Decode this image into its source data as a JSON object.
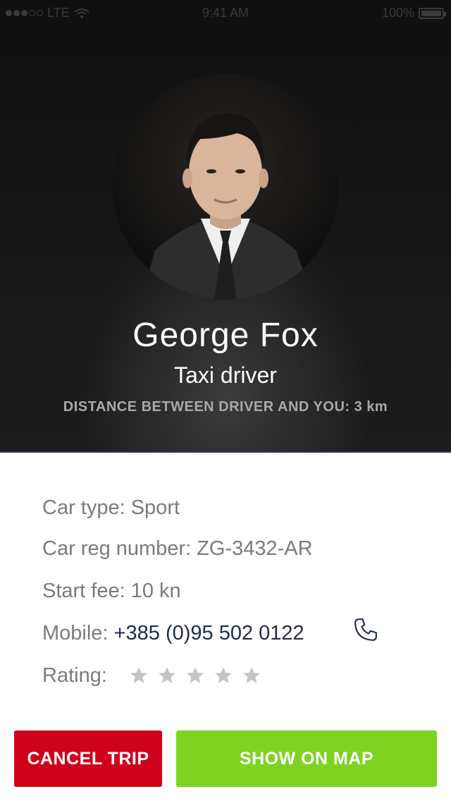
{
  "status_bar": {
    "carrier": "LTE",
    "time": "9:41 AM",
    "battery": "100%"
  },
  "driver": {
    "name": "George Fox",
    "role": "Taxi driver",
    "distance": "DISTANCE BETWEEN DRIVER AND YOU: 3 km"
  },
  "details": {
    "car_type": "Car type: Sport",
    "car_reg": "Car reg number: ZG-3432-AR",
    "start_fee": "Start fee: 10 kn",
    "mobile_label": "Mobile:",
    "mobile_value": "+385 (0)95 502 0122",
    "rating_label": "Rating:",
    "rating_stars": 5,
    "rating_filled": 0
  },
  "actions": {
    "cancel": "CANCEL TRIP",
    "map": "SHOW ON MAP"
  },
  "icons": [
    "wifi-icon",
    "battery-icon",
    "phone-icon",
    "star-icon"
  ],
  "colors": {
    "cancel": "#d0021b",
    "map": "#7ed321",
    "phone": "#1e2b55",
    "star": "#c4c4c4"
  }
}
